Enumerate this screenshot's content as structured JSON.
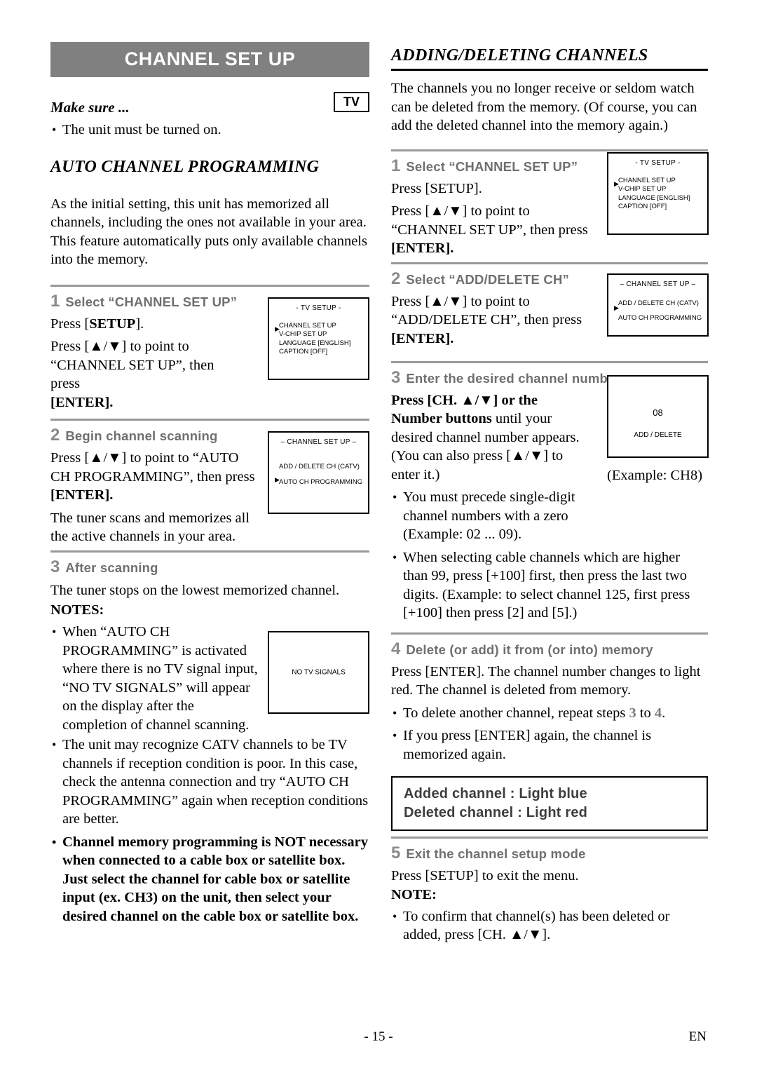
{
  "left": {
    "title": "CHANNEL SET UP",
    "make_sure_label": "Make sure ...",
    "tv_badge": "TV",
    "make_sure_item": "The unit must be turned on.",
    "section_title": "AUTO CHANNEL PROGRAMMING",
    "intro": "As the initial setting, this unit has memorized all channels, including the ones not available in your area. This feature automatically puts only available channels into the memory.",
    "step1": {
      "num": "1",
      "label": "Select “CHANNEL SET UP”",
      "line1_a": "Press [",
      "line1_b": "SETUP",
      "line1_c": "].",
      "line2": "Press [▲/▼] to point to “CHANNEL SET UP”, then press",
      "line3": "[ENTER]."
    },
    "osd1": {
      "title": "- TV SETUP -",
      "rows": [
        "CHANNEL SET UP",
        "V-CHIP SET UP",
        "LANGUAGE  [ENGLISH]",
        "CAPTION   [OFF]"
      ],
      "arrow": "▶"
    },
    "step2": {
      "num": "2",
      "label": "Begin channel scanning",
      "line1": "Press [▲/▼] to point to “AUTO CH PROGRAMMING”, then press",
      "line2": "[ENTER].",
      "line3": "The tuner scans and memorizes all the active channels in your area."
    },
    "osd2": {
      "title": "– CHANNEL SET UP –",
      "rows": [
        "ADD / DELETE CH (CATV)",
        "AUTO CH PROGRAMMING"
      ],
      "arrow": "▶"
    },
    "step3": {
      "num": "3",
      "label": "After scanning",
      "line1": "The tuner stops on the lowest memorized channel."
    },
    "notes_head": "NOTES:",
    "note1": "When “AUTO CH PROGRAMMING” is activated where there is no TV signal input, “NO TV SIGNALS” will appear on the display after the completion of channel scanning.",
    "note2": "The unit may recognize CATV channels to be TV channels if reception condition is poor. In this case, check the antenna connection and try “AUTO CH PROGRAMMING” again when reception conditions are better.",
    "note3": "Channel memory programming is NOT necessary when connected to a cable box or satellite box. Just select the channel for cable box or satellite input (ex. CH3) on the unit, then select your desired channel on the cable box or satellite box.",
    "osd3": {
      "text": "NO  TV  SIGNALS"
    }
  },
  "right": {
    "section_title": "ADDING/DELETING CHANNELS",
    "intro": "The channels you no longer receive or seldom watch can be deleted from the memory. (Of course, you can add the deleted channel into the memory again.)",
    "step1": {
      "num": "1",
      "label": "Select “CHANNEL SET UP”",
      "line1": "Press [SETUP].",
      "line2": "Press [▲/▼] to point to “CHANNEL SET UP”, then press",
      "line3": "[ENTER]."
    },
    "osd1": {
      "title": "- TV SETUP -",
      "rows": [
        "CHANNEL SET UP",
        "V-CHIP SET UP",
        "LANGUAGE  [ENGLISH]",
        "CAPTION   [OFF]"
      ],
      "arrow": "▶"
    },
    "step2": {
      "num": "2",
      "label": "Select “ADD/DELETE CH”",
      "line1": "Press [▲/▼] to point to “ADD/DELETE CH”, then press",
      "line2": "[ENTER]."
    },
    "osd2": {
      "title": "– CHANNEL SET UP –",
      "rows": [
        "ADD / DELETE CH (CATV)",
        "AUTO CH PROGRAMMING"
      ],
      "arrow": "▶"
    },
    "step3": {
      "num": "3",
      "label": "Enter the desired channel number",
      "line1_bold": "Press [CH. ▲/▼] or the Number buttons",
      "line1_rest": " until your desired channel number appears. (You can also press [▲/▼] to enter it.)",
      "bullet1": "You must precede single-digit channel numbers with a zero (Example: 02 ...   09).",
      "bullet2": "When selecting cable channels which are higher than 99, press [+100] first, then press the last two digits. (Example: to select channel 125, first press [+100] then press [2] and [5].)",
      "example_caption": "(Example: CH8)"
    },
    "osd3": {
      "channel": "08",
      "label": "ADD / DELETE"
    },
    "step4": {
      "num": "4",
      "label": "Delete (or add) it from (or into) memory",
      "line1": "Press [ENTER]. The channel number changes to light red. The channel is deleted from memory.",
      "bullet1_a": "To delete another channel, repeat steps ",
      "bullet1_n1": "3",
      "bullet1_b": " to ",
      "bullet1_n2": "4",
      "bullet1_c": ".",
      "bullet2": "If you press [ENTER] again, the channel is memorized again."
    },
    "highlight": {
      "line1": "Added channel  : Light blue",
      "line2": "Deleted channel : Light red"
    },
    "step5": {
      "num": "5",
      "label": "Exit the channel setup mode",
      "line1": "Press [SETUP] to exit the menu.",
      "note_head": "NOTE:",
      "bullet1": "To confirm that channel(s) has been deleted or added, press [CH. ▲/▼]."
    }
  },
  "footer": {
    "page": "- 15 -",
    "lang": "EN"
  }
}
